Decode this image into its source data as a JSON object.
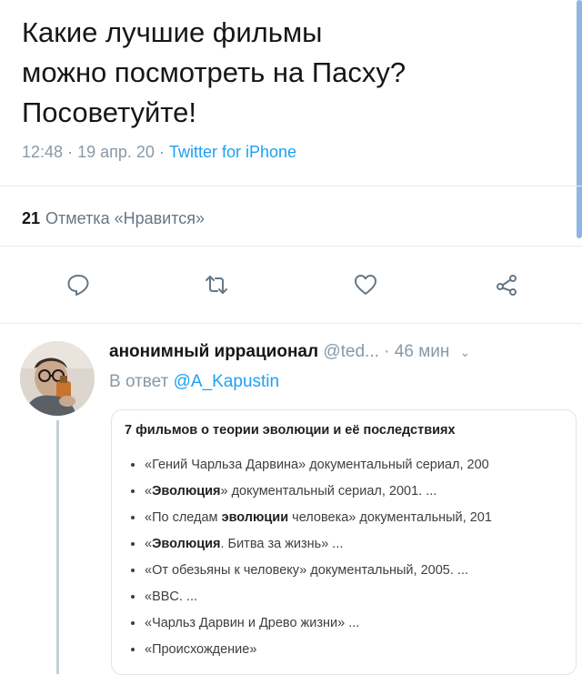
{
  "tweet": {
    "text": "Какие лучшие фильмы\nможно посмотреть на Пасху?\nПосоветуйте!",
    "time": "12:48",
    "date": "19 апр. 20",
    "source": "Twitter for iPhone",
    "sep": "·",
    "likes_count": "21",
    "likes_label": "Отметка «Нравится»"
  },
  "actions": {
    "icons": [
      "reply-icon",
      "retweet-icon",
      "like-icon",
      "share-icon"
    ]
  },
  "reply": {
    "name": "анонимный иррационал",
    "handle": "@ted...",
    "time": "· 46 мин",
    "chevron": "⌄",
    "reply_prefix": "В ответ",
    "reply_mention": "@A_Kapustin",
    "card": {
      "title": "7 фильмов о теории эволюции и её последствиях",
      "items": [
        {
          "pre": "«Гений Чарльза Дарвина» документальный сериал, 200",
          "bold": "",
          "post": ""
        },
        {
          "pre": "«",
          "bold": "Эволюция",
          "post": "» документальный сериал, 2001. ..."
        },
        {
          "pre": "«По следам ",
          "bold": "эволюции",
          "post": " человека» документальный, 201"
        },
        {
          "pre": "«",
          "bold": "Эволюция",
          "post": ". Битва за жизнь» ..."
        },
        {
          "pre": "«От обезьяны к человеку» документальный, 2005. ...",
          "bold": "",
          "post": ""
        },
        {
          "pre": "«BBC. ...",
          "bold": "",
          "post": ""
        },
        {
          "pre": "«Чарльз Дарвин и Древо жизни» ...",
          "bold": "",
          "post": ""
        },
        {
          "pre": "«Происхождение»",
          "bold": "",
          "post": ""
        }
      ]
    }
  },
  "colors": {
    "text": "#14171a",
    "muted": "#8899a6",
    "link": "#1da1f2",
    "icon": "#657786"
  }
}
